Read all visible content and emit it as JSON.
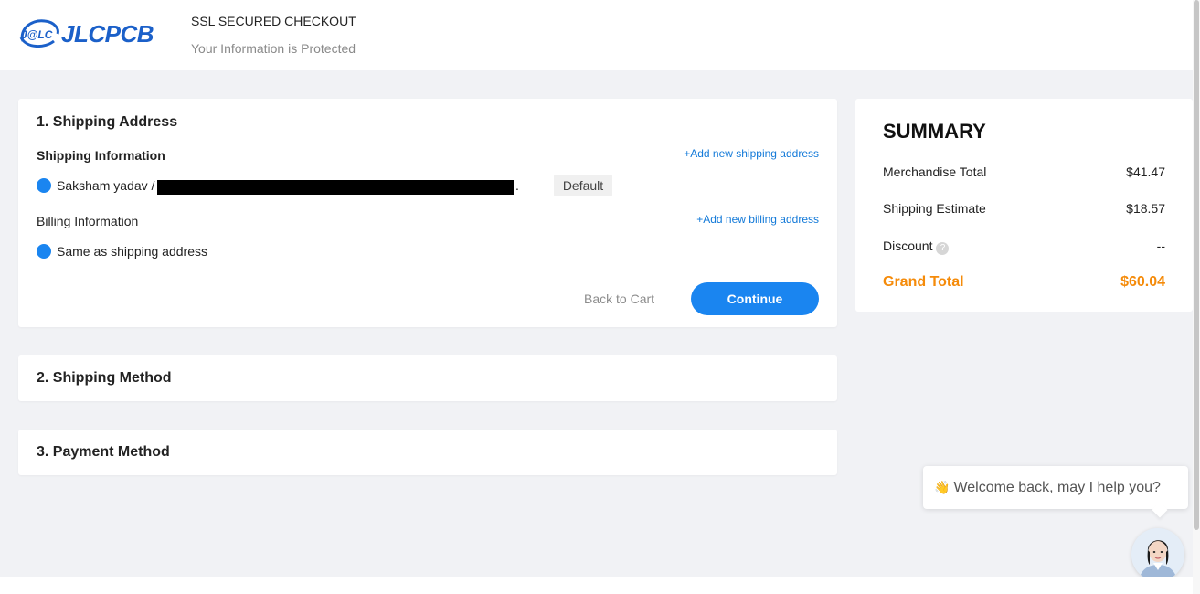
{
  "header": {
    "logo_text": "JLCPCB",
    "logo_mark": "J@LC",
    "ssl_title": "SSL SECURED CHECKOUT",
    "ssl_subtitle": "Your Information is Protected"
  },
  "shipping_address": {
    "title": "1. Shipping Address",
    "shipping_info_label": "Shipping Information",
    "add_shipping_link": "+Add new shipping address",
    "address_name": "Saksham yadav /",
    "address_trailing": ".",
    "default_badge": "Default",
    "billing_info_label": "Billing Information",
    "add_billing_link": "+Add new billing address",
    "same_as_shipping": "Same as shipping address",
    "back_to_cart": "Back to Cart",
    "continue_label": "Continue"
  },
  "shipping_method": {
    "title": "2. Shipping Method"
  },
  "payment_method": {
    "title": "3. Payment Method"
  },
  "summary": {
    "title": "SUMMARY",
    "merchandise_label": "Merchandise Total",
    "merchandise_value": "$41.47",
    "shipping_label": "Shipping Estimate",
    "shipping_value": "$18.57",
    "discount_label": "Discount",
    "discount_value": "--",
    "grand_label": "Grand Total",
    "grand_value": "$60.04"
  },
  "chat": {
    "wave_icon": "👋",
    "message": "Welcome back, may I help you?"
  },
  "colors": {
    "accent_blue": "#1a85f0",
    "link_blue": "#1279d8",
    "grand_total_orange": "#f58b0a",
    "brand_blue": "#1b60c9"
  }
}
